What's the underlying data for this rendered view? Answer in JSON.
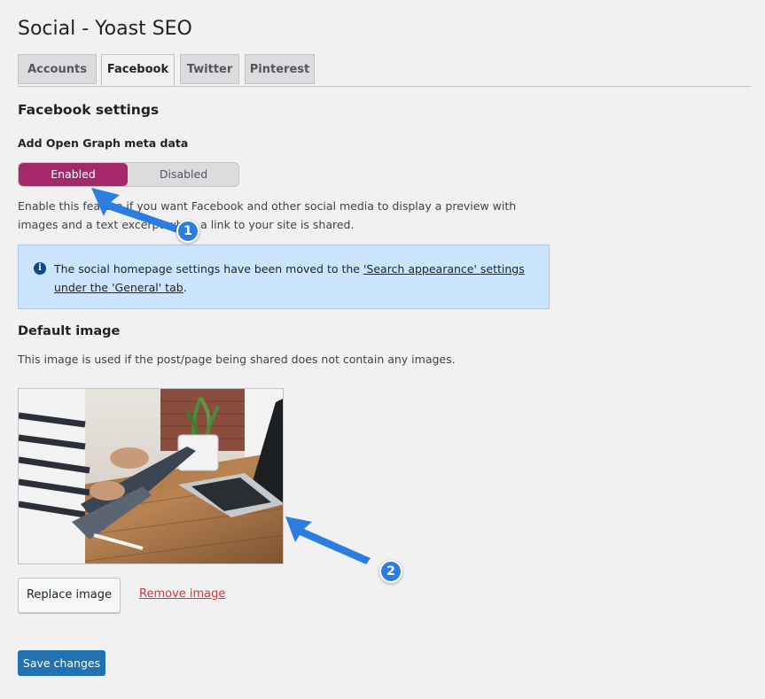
{
  "page": {
    "title": "Social - Yoast SEO"
  },
  "tabs": [
    {
      "label": "Accounts",
      "active": false
    },
    {
      "label": "Facebook",
      "active": true
    },
    {
      "label": "Twitter",
      "active": false
    },
    {
      "label": "Pinterest",
      "active": false
    }
  ],
  "facebook": {
    "heading": "Facebook settings",
    "og_label": "Add Open Graph meta data",
    "toggle": {
      "enabled_label": "Enabled",
      "disabled_label": "Disabled",
      "selected": "Enabled"
    },
    "description": "Enable this feature if you want Facebook and other social media to display a preview with images and a text excerpt when a link to your site is shared."
  },
  "notice": {
    "text_before": "The social homepage settings have been moved to the ",
    "link_text": "'Search appearance' settings under the 'General' tab",
    "text_after": ".",
    "icon": "info-icon"
  },
  "default_image": {
    "heading": "Default image",
    "description": "This image is used if the post/page being shared does not contain any images.",
    "replace_label": "Replace image",
    "remove_label": "Remove image"
  },
  "footer": {
    "save_label": "Save changes"
  },
  "annotations": [
    {
      "number": "1"
    },
    {
      "number": "2"
    }
  ],
  "colors": {
    "toggle_on": "#a4286a",
    "primary_button": "#2271b1",
    "notice_bg": "#cce5ff",
    "remove_link": "#d63638",
    "annotation": "#2b7de0"
  }
}
